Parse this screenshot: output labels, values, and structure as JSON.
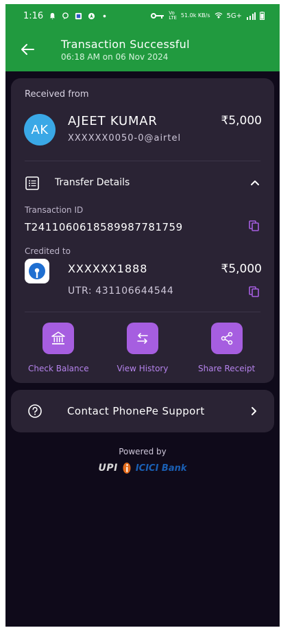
{
  "status_bar": {
    "time": "1:16",
    "net_speed": "51.0k KB/s",
    "network": "5G+"
  },
  "header": {
    "title": "Transaction Successful",
    "subtitle": "06:18 AM on 06 Nov 2024"
  },
  "received": {
    "label": "Received from",
    "avatar_initials": "AK",
    "name": "AJEET KUMAR",
    "upi_id": "XXXXXX0050-0@airtel",
    "amount": "₹5,000"
  },
  "transfer_details": {
    "label": "Transfer Details",
    "transaction_id_label": "Transaction ID",
    "transaction_id": "T2411060618589987781759",
    "credited_to_label": "Credited to",
    "account": "XXXXXX1888",
    "account_amount": "₹5,000",
    "utr": "UTR: 431106644544"
  },
  "actions": [
    {
      "label": "Check Balance",
      "icon": "bank-icon"
    },
    {
      "label": "View History",
      "icon": "swap-arrows-icon"
    },
    {
      "label": "Share Receipt",
      "icon": "share-icon"
    }
  ],
  "support": {
    "label": "Contact PhonePe Support"
  },
  "footer": {
    "powered_by": "Powered by",
    "upi_brand": "UPI",
    "bank_brand": "ICICI Bank"
  },
  "colors": {
    "header_green": "#219a3f",
    "background": "#0f0a1a",
    "card": "#2a2334",
    "accent_purple": "#a65ee0"
  }
}
